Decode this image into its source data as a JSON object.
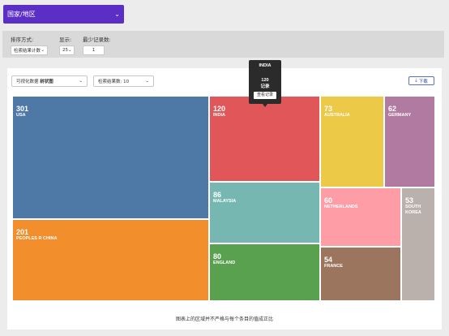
{
  "country_dropdown": {
    "label": "国家/地区"
  },
  "filters": {
    "sort": {
      "label": "排序方式:",
      "value": "检索结果计数"
    },
    "show": {
      "label": "显示:",
      "value": "25"
    },
    "min_records": {
      "label": "最少记录数:",
      "value": "1"
    }
  },
  "toolbar": {
    "viz_prefix": "可视化数据",
    "viz_value": "树状图",
    "results_label": "检索结果数: 10",
    "download_label": "下载"
  },
  "colors": {
    "usa": "#4e79a7",
    "india": "#e15759",
    "australia": "#edc948",
    "germany": "#b07aa1",
    "malaysia": "#76b7b2",
    "netherlands": "#ff9da7",
    "peoples_r_china": "#f28e2b",
    "england": "#59a14f",
    "france": "#9c755f",
    "south_korea": "#bab0ac"
  },
  "chart_data": {
    "type": "treemap",
    "items": [
      {
        "name": "USA",
        "value": 301
      },
      {
        "name": "PEOPLES R CHINA",
        "value": 201
      },
      {
        "name": "INDIA",
        "value": 120
      },
      {
        "name": "MALAYSIA",
        "value": 86
      },
      {
        "name": "ENGLAND",
        "value": 80
      },
      {
        "name": "AUSTRALIA",
        "value": 73
      },
      {
        "name": "GERMANY",
        "value": 62
      },
      {
        "name": "NETHERLANDS",
        "value": 60
      },
      {
        "name": "FRANCE",
        "value": 54
      },
      {
        "name": "SOUTH KOREA",
        "value": 53
      }
    ]
  },
  "tooltip": {
    "country": "INDIA",
    "count": "120",
    "unit": "记录",
    "button": "查看记录"
  },
  "footnote": "图表上的区域并不严格与每个条目的值成正比"
}
